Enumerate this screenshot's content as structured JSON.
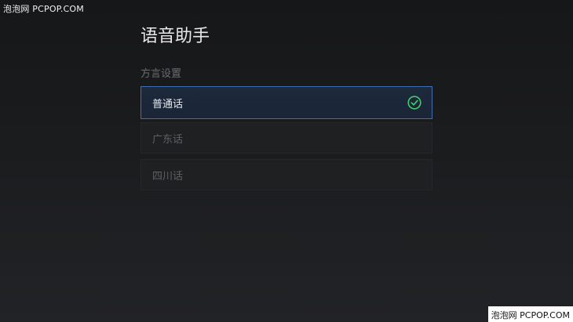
{
  "watermarks": {
    "top": "泡泡网 PCPOP.COM",
    "bottom": "泡泡网 PCPOP.COM"
  },
  "header": {
    "title": "语音助手"
  },
  "dialect_section": {
    "label": "方言设置",
    "options": [
      {
        "label": "普通话",
        "selected": true
      },
      {
        "label": "广东话",
        "selected": false
      },
      {
        "label": "四川话",
        "selected": false
      }
    ]
  },
  "icons": {
    "selected_indicator": "check-circle-icon"
  },
  "colors": {
    "accent_border": "#3f6fae",
    "check": "#3ecb6a"
  }
}
